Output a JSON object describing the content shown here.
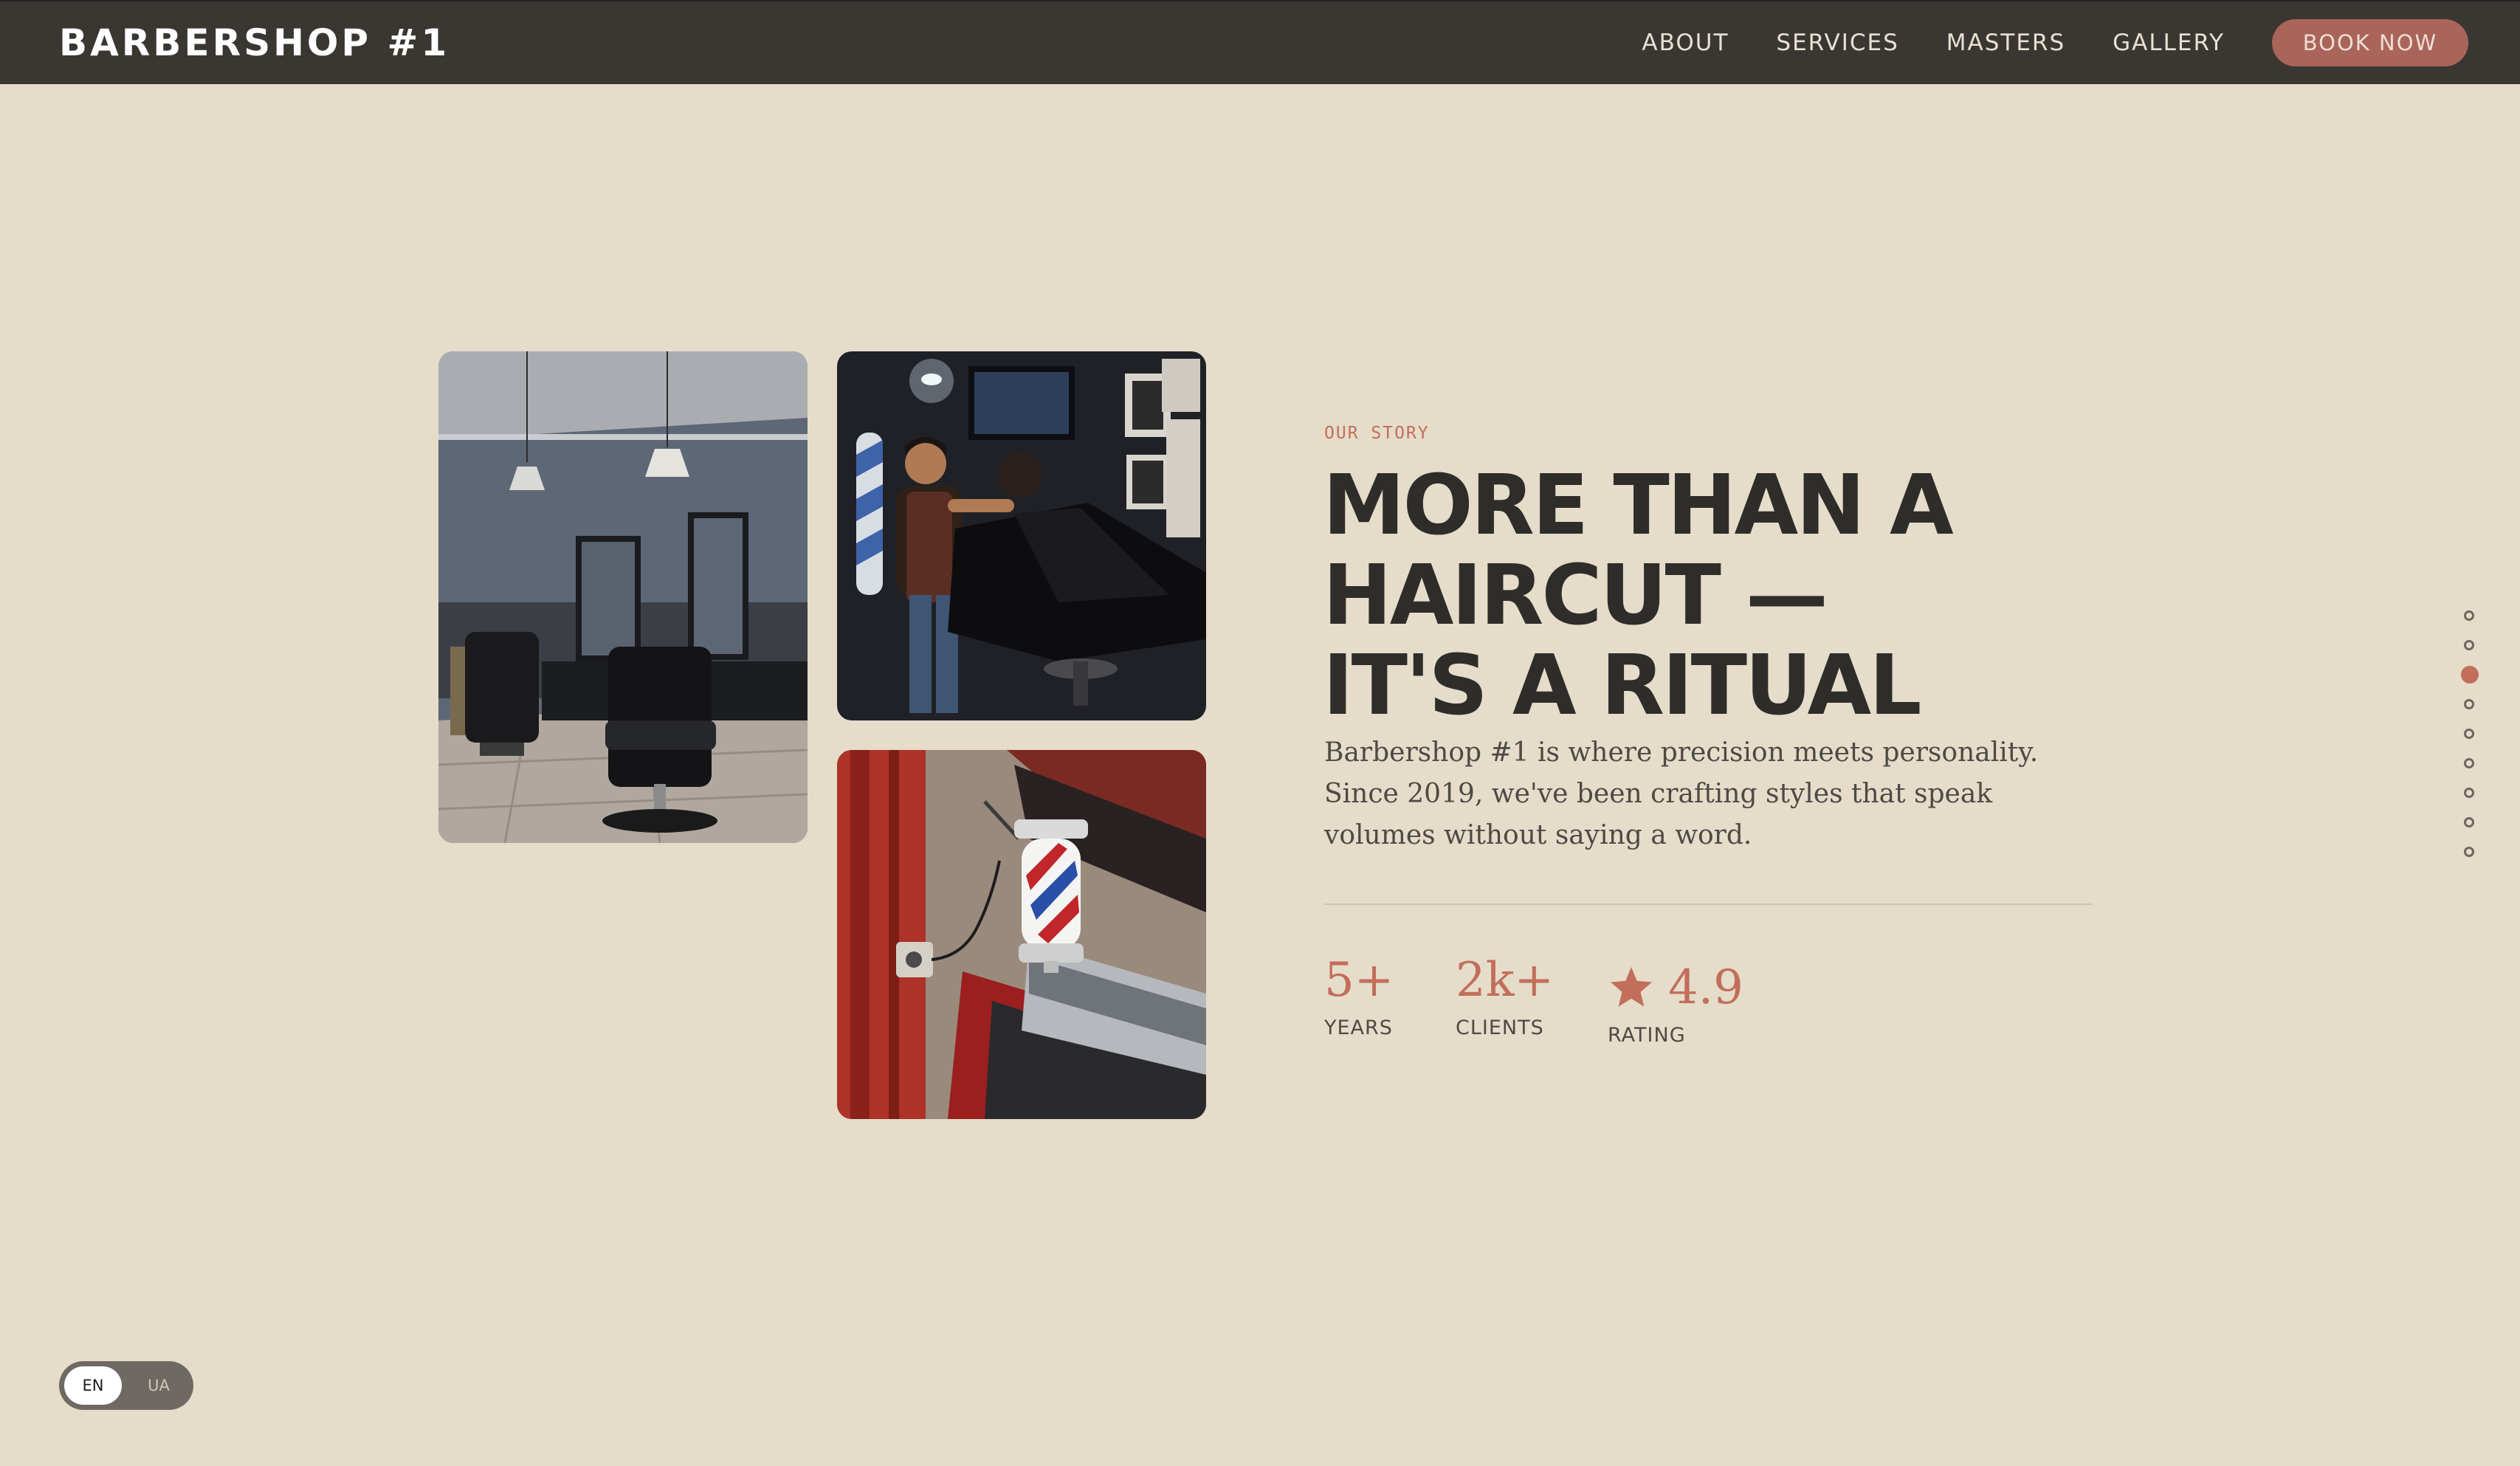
{
  "header": {
    "logo": "BARBERSHOP #1",
    "nav": [
      "ABOUT",
      "SERVICES",
      "MASTERS",
      "GALLERY"
    ],
    "cta": "BOOK NOW"
  },
  "story": {
    "eyebrow": "OUR STORY",
    "headline": [
      "MORE THAN A",
      "HAIRCUT —",
      "IT'S A RITUAL"
    ],
    "paragraph": "Barbershop #1 is where precision meets personality. Since 2019, we've been crafting styles that speak volumes without saying a word.",
    "stats": {
      "years": {
        "value": "5+",
        "label": "YEARS"
      },
      "clients": {
        "value": "2k+",
        "label": "CLIENTS"
      },
      "rating": {
        "value": "4.9",
        "label": "RATING",
        "icon": "star-icon"
      }
    }
  },
  "section_nav": {
    "count": 9,
    "active_index": 2
  },
  "language": {
    "options": [
      "EN",
      "UA"
    ],
    "selected": "EN"
  },
  "colors": {
    "background": "#e5dcca",
    "header": "#3a3733",
    "accent": "#c26e5a",
    "button": "#a9655a",
    "text_dark": "#2f2d2a"
  }
}
